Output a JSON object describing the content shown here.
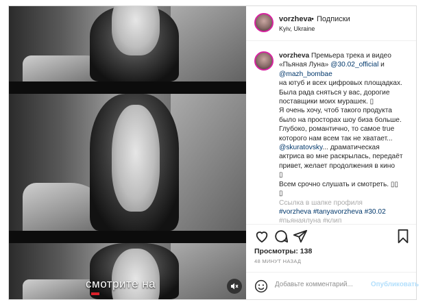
{
  "post": {
    "username": "vorzheva",
    "dot": "•",
    "follow_label": "Подписки",
    "location": "Kyiv, Ukraine",
    "video_overlay_text": "смотрите на"
  },
  "caption": {
    "author": "vorzheva",
    "lines": [
      {
        "segments": [
          {
            "text": "Премьера трека и видео"
          }
        ]
      },
      {
        "segments": [
          {
            "text": "«Пьяная Луна» "
          },
          {
            "text": "@30.02_official",
            "link": true
          },
          {
            "text": " и"
          }
        ]
      },
      {
        "segments": [
          {
            "text": "@mazh_bombae",
            "link": true
          }
        ]
      },
      {
        "segments": [
          {
            "text": "на ютуб и всех цифровых площадках."
          }
        ]
      },
      {
        "segments": [
          {
            "text": "Была рада сняться у вас, дорогие"
          }
        ]
      },
      {
        "segments": [
          {
            "text": "поставщики моих мурашек. ▯"
          }
        ]
      },
      {
        "segments": [
          {
            "text": "Я очень хочу, чтоб такого продукта"
          }
        ]
      },
      {
        "segments": [
          {
            "text": "было на просторах шоу биза больше."
          }
        ]
      },
      {
        "segments": [
          {
            "text": "Глубоко, романтично, то самое true"
          }
        ]
      },
      {
        "segments": [
          {
            "text": "которого нам всем так не хватает..."
          }
        ]
      },
      {
        "segments": [
          {
            "text": "@skuratovsky",
            "link": true
          },
          {
            "text": "... драматическая"
          }
        ]
      },
      {
        "segments": [
          {
            "text": "актриса во мне раскрылась, передаёт"
          }
        ]
      },
      {
        "segments": [
          {
            "text": "привет, желает продолжения в кино"
          }
        ]
      },
      {
        "segments": [
          {
            "text": "▯"
          }
        ]
      },
      {
        "segments": [
          {
            "text": "Всем срочно слушать и смотреть. ▯▯"
          }
        ]
      },
      {
        "segments": [
          {
            "text": "▯"
          }
        ]
      },
      {
        "segments": [
          {
            "text": "Ссылка в шапке профиля",
            "faded": true
          }
        ]
      },
      {
        "segments": [
          {
            "text": "#vorzheva #tanyavorzheva #30.02",
            "link": true
          }
        ]
      },
      {
        "segments": [
          {
            "text": "#пьянаялуна #клип",
            "link": true,
            "faded": true
          }
        ]
      }
    ]
  },
  "actions": {
    "icons": [
      "heart-icon",
      "comment-icon",
      "share-icon",
      "bookmark-icon"
    ]
  },
  "views_text": "Просмотры: 138",
  "time_text": "48 МИНУТ НАЗАД",
  "comment_box": {
    "placeholder": "Добавьте комментарий...",
    "publish_label": "Опубликовать"
  },
  "colors": {
    "link": "#00376b",
    "publish_disabled": "#b2dffc",
    "story_ring": "#d6249f"
  }
}
